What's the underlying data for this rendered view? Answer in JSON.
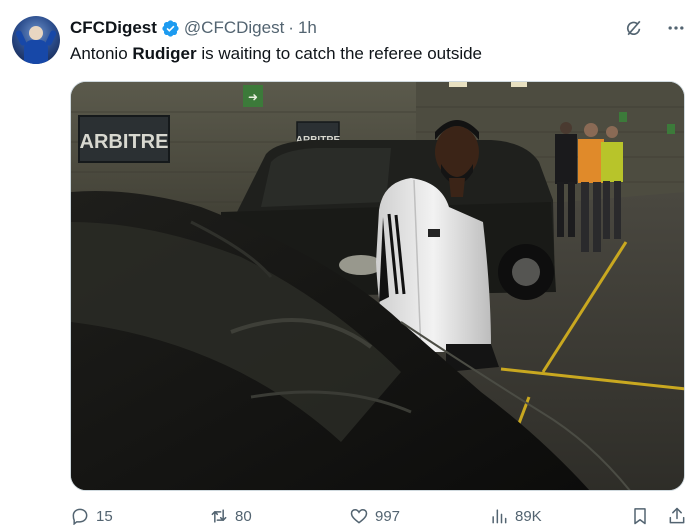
{
  "author": {
    "display_name": "CFCDigest",
    "handle": "@CFCDigest",
    "separator": "·",
    "time": "1h"
  },
  "tweet": {
    "text_before": "Antonio ",
    "text_bold": "Rudiger",
    "text_after": " is waiting to catch the referee outside"
  },
  "media": {
    "signs": [
      "ARBITRE",
      "ARBITRE"
    ]
  },
  "actions": {
    "replies": "15",
    "reposts": "80",
    "likes": "997",
    "views": "89K"
  },
  "colors": {
    "verified_blue": "#1d9bf0",
    "muted_text": "#536471",
    "primary_text": "#0f1419"
  },
  "icons": [
    "verified-badge-icon",
    "grok-icon",
    "more-icon",
    "reply-icon",
    "retweet-icon",
    "like-icon",
    "views-icon",
    "bookmark-icon",
    "share-icon"
  ]
}
